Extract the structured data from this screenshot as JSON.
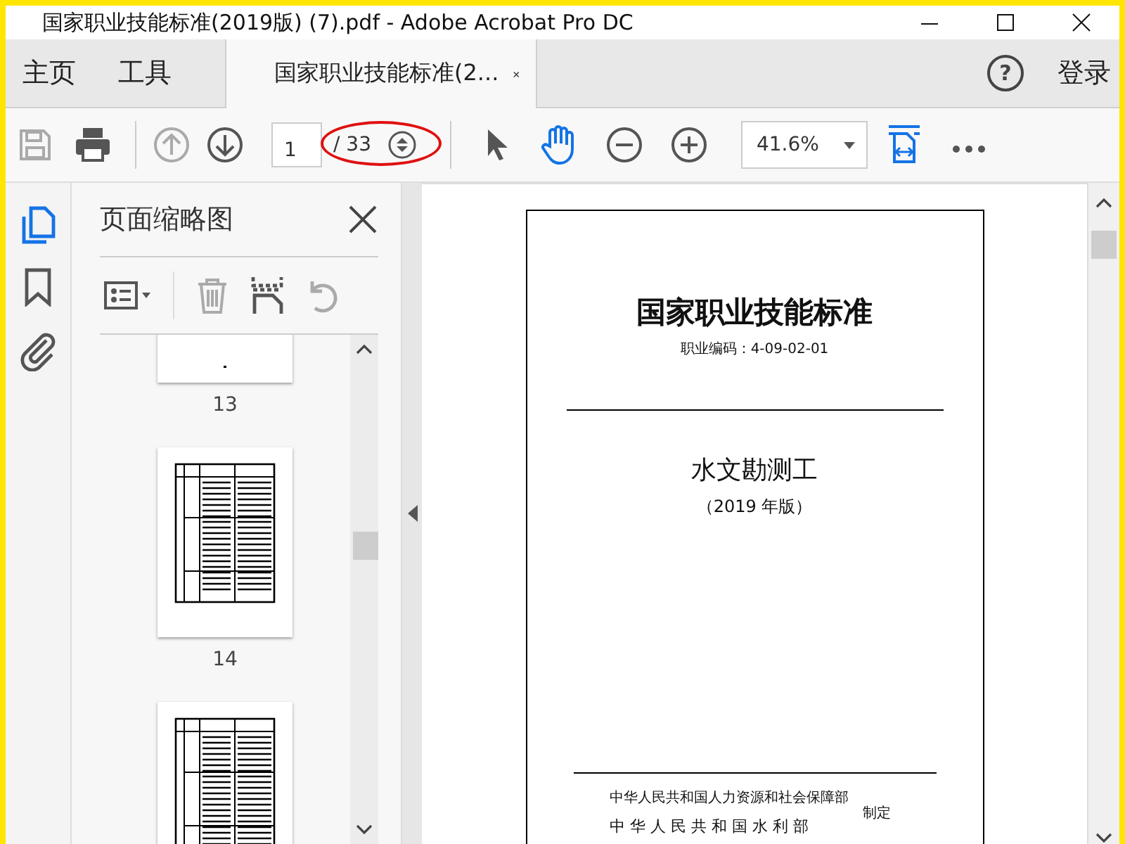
{
  "window": {
    "title": "国家职业技能标准(2019版) (7).pdf - Adobe Acrobat Pro DC"
  },
  "nav": {
    "items": [
      {
        "label": "主页"
      },
      {
        "label": "工具"
      }
    ],
    "tabs": [
      {
        "label": "国家职业技能标准(2...",
        "selected": true
      }
    ],
    "help": "?",
    "login": "登录"
  },
  "toolbar": {
    "page_value": "1",
    "page_total": "/ 33",
    "zoom": "41.6%"
  },
  "side_panel": {
    "title": "页面缩略图",
    "thumbnails": [
      {
        "label": "13",
        "kind": "blank"
      },
      {
        "label": "14",
        "kind": "table"
      },
      {
        "kind": "table"
      }
    ]
  },
  "document": {
    "title": "国家职业技能标准",
    "code": "职业编码：4-09-02-01",
    "subtitle": "水文勘测工",
    "edition": "（2019 年版）",
    "issuers": [
      "中华人民共和国人力资源和社会保障部",
      "中 华 人 民 共 和 国 水 利 部"
    ],
    "issued": "制定"
  }
}
